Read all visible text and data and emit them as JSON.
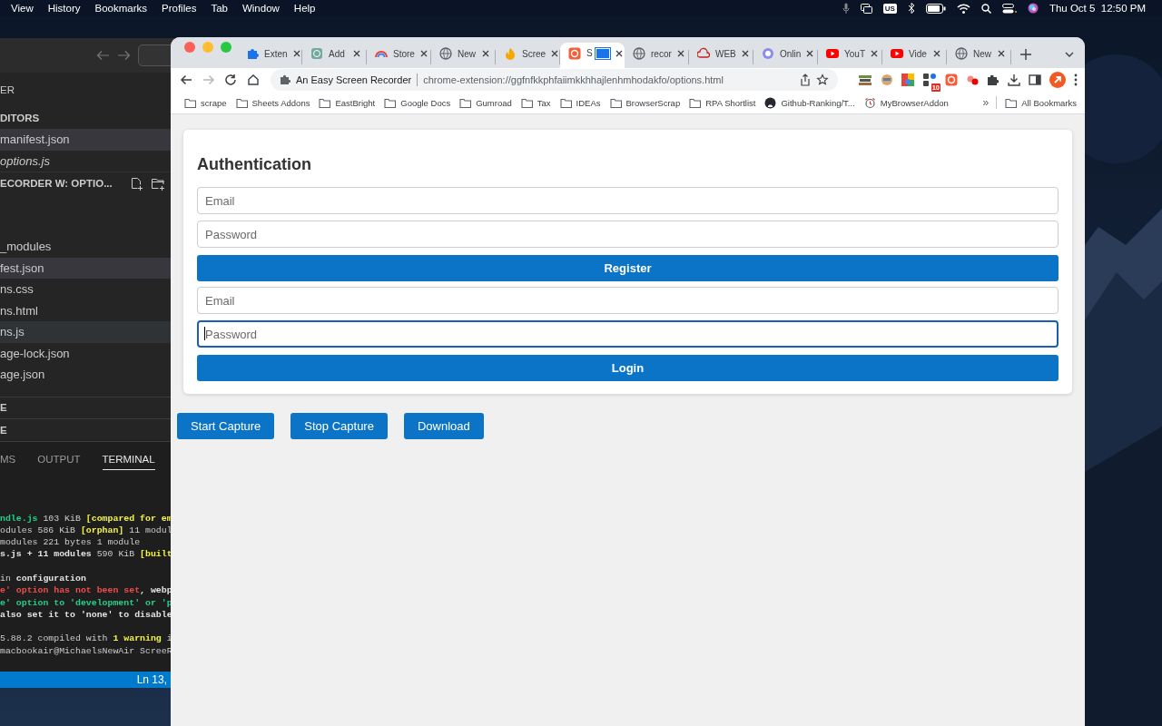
{
  "menubar": {
    "menus": [
      "View",
      "History",
      "Bookmarks",
      "Profiles",
      "Tab",
      "Window",
      "Help"
    ],
    "keyboard": "US",
    "clock": "Thu Oct 5  12:50 PM"
  },
  "editor": {
    "explorer_title": "ER",
    "open_editors_title": "DITORS",
    "open_editors": [
      {
        "name": "manifest.json",
        "selected": true,
        "preview": false
      },
      {
        "name": "options.js",
        "selected": false,
        "preview": true
      }
    ],
    "folder_title": "ECORDER W: OPTIO...",
    "files": [
      {
        "name": "_modules",
        "selected": false,
        "hovered": false
      },
      {
        "name": "fest.json",
        "selected": true,
        "hovered": false
      },
      {
        "name": "ns.css",
        "selected": false,
        "hovered": false
      },
      {
        "name": "ns.html",
        "selected": false,
        "hovered": false
      },
      {
        "name": "ns.js",
        "selected": false,
        "hovered": true
      },
      {
        "name": "age-lock.json",
        "selected": false,
        "hovered": false
      },
      {
        "name": "age.json",
        "selected": false,
        "hovered": false
      }
    ],
    "sections": [
      "E",
      "E"
    ],
    "panel_tabs": [
      {
        "label": "MS",
        "selected": false
      },
      {
        "label": "OUTPUT",
        "selected": false
      },
      {
        "label": "TERMINAL",
        "selected": true
      }
    ],
    "terminal": [
      [
        [
          {
            "text": "ndle.js",
            "kind": "green"
          },
          {
            "text": " 103 KiB ",
            "kind": "plain"
          },
          {
            "text": "[compared for em",
            "kind": "yellow"
          }
        ],
        [
          {
            "text": "odules 586 KiB ",
            "kind": "plain"
          },
          {
            "text": "[orphan]",
            "kind": "yellow"
          },
          {
            "text": " 11 modul",
            "kind": "plain"
          }
        ],
        [
          {
            "text": "modules 221 bytes 1 module",
            "kind": "plain"
          }
        ],
        [
          {
            "text": "s.js + 11 modules",
            "kind": "bold"
          },
          {
            "text": " 590 KiB ",
            "kind": "plain"
          },
          {
            "text": "[built",
            "kind": "yellow"
          }
        ]
      ],
      [
        [
          {
            "text": "in ",
            "kind": "plain"
          },
          {
            "text": "configuration",
            "kind": "bold"
          }
        ],
        [
          {
            "text": "e' option has not been set",
            "kind": "red"
          },
          {
            "text": ", webp",
            "kind": "bold"
          }
        ],
        [
          {
            "text": "e' option to 'development' or 'p",
            "kind": "green"
          }
        ],
        [
          {
            "text": "also set it to 'none' to disable",
            "kind": "bold"
          }
        ]
      ],
      [
        [
          {
            "text": "5.88.2 compiled with ",
            "kind": "plain"
          },
          {
            "text": "1 warning",
            "kind": "yellow"
          },
          {
            "text": " i",
            "kind": "plain"
          }
        ],
        [
          {
            "text": "macbookair@MichaelsNewAir ScreeR",
            "kind": "plain"
          }
        ]
      ]
    ],
    "status": "Ln 13,"
  },
  "browser": {
    "tabs": [
      {
        "label": "Exten",
        "selected": false
      },
      {
        "label": "Add",
        "selected": false
      },
      {
        "label": "Store",
        "selected": false
      },
      {
        "label": "New",
        "selected": false
      },
      {
        "label": "Scree",
        "selected": false
      },
      {
        "label": "S",
        "selected": true
      },
      {
        "label": "recor",
        "selected": false
      },
      {
        "label": "WEB",
        "selected": false
      },
      {
        "label": "Onlin",
        "selected": false
      },
      {
        "label": "YouT",
        "selected": false
      },
      {
        "label": "Vide",
        "selected": false
      },
      {
        "label": "New",
        "selected": false
      }
    ],
    "nav": [
      {
        "kind": "back",
        "disabled": false
      },
      {
        "kind": "forward",
        "disabled": true
      },
      {
        "kind": "reload",
        "disabled": false
      },
      {
        "kind": "home",
        "disabled": false
      }
    ],
    "site_name": "An Easy Screen Recorder",
    "url": "chrome-extension://ggfnfkkphfaiimkkhhajlenhmhodakfo/options.html",
    "extension_badge": "10",
    "bookmarks": [
      {
        "label": "scrape",
        "kind": "folder"
      },
      {
        "label": "Sheets Addons",
        "kind": "folder"
      },
      {
        "label": "EastBright",
        "kind": "folder"
      },
      {
        "label": "Google Docs",
        "kind": "folder"
      },
      {
        "label": "Gumroad",
        "kind": "folder"
      },
      {
        "label": "Tax",
        "kind": "folder"
      },
      {
        "label": "IDEAs",
        "kind": "folder"
      },
      {
        "label": "BrowserScrap",
        "kind": "folder"
      },
      {
        "label": "RPA Shortlist",
        "kind": "folder"
      },
      {
        "label": "Github-Ranking/T...",
        "kind": "github"
      },
      {
        "label": "MyBrowserAddon",
        "kind": "alarm"
      }
    ],
    "overflow": "»",
    "all_bookmarks": "All Bookmarks"
  },
  "page": {
    "heading": "Authentication",
    "form": [
      {
        "kind": "field",
        "placeholder": "Email",
        "focused": false
      },
      {
        "kind": "field",
        "placeholder": "Password",
        "focused": false
      },
      {
        "kind": "button",
        "label": "Register"
      },
      {
        "kind": "field",
        "placeholder": "Email",
        "focused": false
      },
      {
        "kind": "field",
        "placeholder": "Password",
        "focused": true
      },
      {
        "kind": "button",
        "label": "Login"
      }
    ],
    "actions": [
      "Start Capture",
      "Stop Capture",
      "Download"
    ]
  }
}
